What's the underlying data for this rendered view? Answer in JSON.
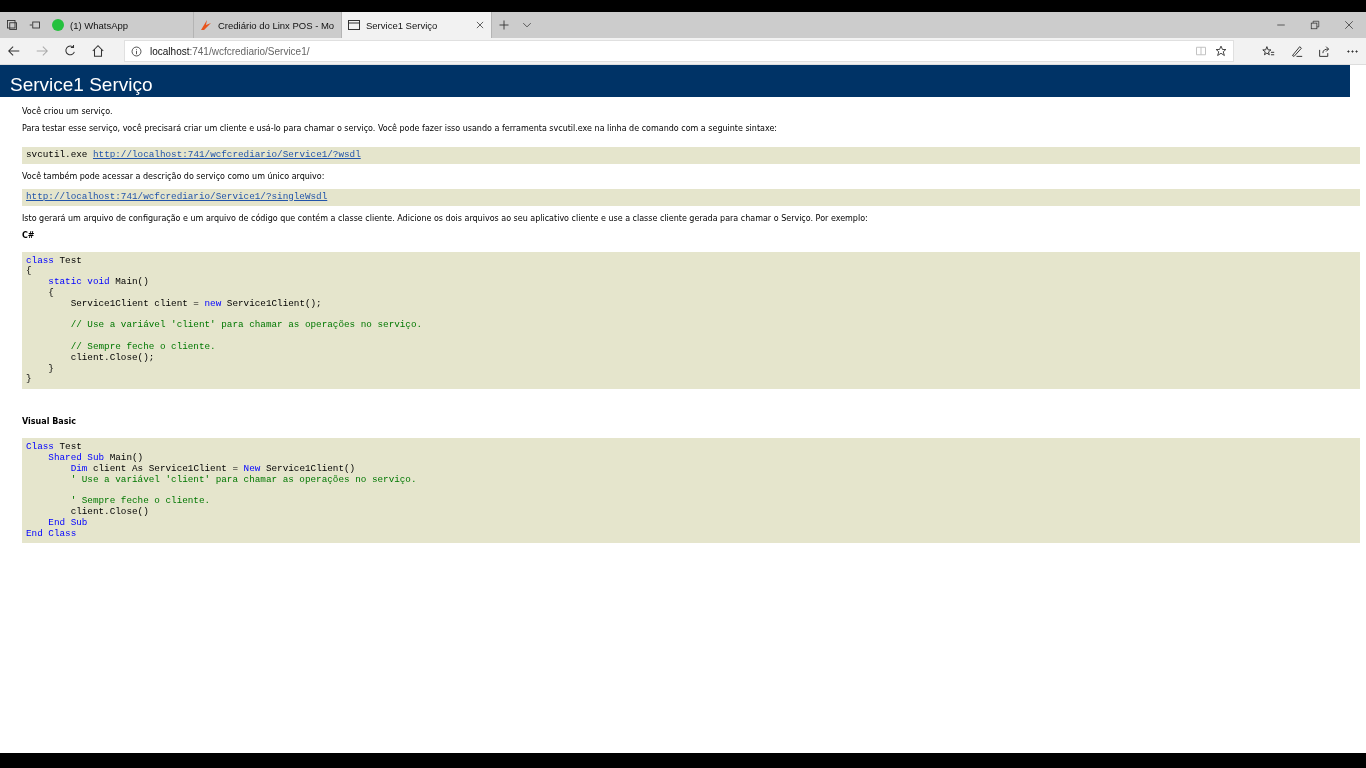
{
  "browser": {
    "tabs": [
      {
        "title": "(1) WhatsApp",
        "kind": "chat",
        "selected": false
      },
      {
        "title": "Crediário do Linx POS - Mo",
        "kind": "flame",
        "selected": false
      },
      {
        "title": "Service1 Serviço",
        "kind": "page",
        "selected": true
      }
    ],
    "address": {
      "host": "localhost",
      "path": ":741/wcfcrediario/Service1/"
    }
  },
  "page": {
    "heading": "Service1 Serviço",
    "intro": "Você criou um serviço.",
    "instructions": "Para testar esse serviço, você precisará criar um cliente e usá-lo para chamar o serviço. Você pode fazer isso usando a ferramenta svcutil.exe na linha de comando com a seguinte sintaxe:",
    "command": {
      "program": "svcutil.exe",
      "link": "http://localhost:741/wcfcrediario/Service1/?wsdl"
    },
    "single_file_text": "Você também pode acessar a descrição do serviço como um único arquivo:",
    "single_file_link": "http://localhost:741/wcfcrediario/Service1/?singleWsdl",
    "generates_text": "Isto gerará um arquivo de configuração e um arquivo de código que contém a classe cliente. Adicione os dois arquivos ao seu aplicativo cliente e use a classe cliente gerada para chamar o Serviço. Por exemplo:",
    "examples": [
      {
        "language": "C#",
        "lines": [
          {
            "kind": "code",
            "tokens": [
              {
                "kind": "keyword",
                "text": "class"
              },
              {
                "kind": "plain",
                "text": " Test"
              }
            ]
          },
          {
            "kind": "code",
            "tokens": [
              {
                "kind": "plain",
                "text": "{"
              }
            ]
          },
          {
            "kind": "code",
            "tokens": [
              {
                "kind": "keyword",
                "text": "    static void"
              },
              {
                "kind": "plain",
                "text": " Main()"
              }
            ]
          },
          {
            "kind": "code",
            "tokens": [
              {
                "kind": "plain",
                "text": "    {"
              }
            ]
          },
          {
            "kind": "code",
            "tokens": [
              {
                "kind": "plain",
                "text": "        Service1Client client = "
              },
              {
                "kind": "keyword",
                "text": "new"
              },
              {
                "kind": "plain",
                "text": " Service1Client();"
              }
            ]
          },
          {
            "kind": "blank"
          },
          {
            "kind": "code",
            "tokens": [
              {
                "kind": "comment",
                "text": "        // Use a variável 'client' para chamar as operações no serviço."
              }
            ]
          },
          {
            "kind": "blank"
          },
          {
            "kind": "code",
            "tokens": [
              {
                "kind": "comment",
                "text": "        // Sempre feche o cliente."
              }
            ]
          },
          {
            "kind": "code",
            "tokens": [
              {
                "kind": "plain",
                "text": "        client.Close();"
              }
            ]
          },
          {
            "kind": "code",
            "tokens": [
              {
                "kind": "plain",
                "text": "    }"
              }
            ]
          },
          {
            "kind": "code",
            "tokens": [
              {
                "kind": "plain",
                "text": "}"
              }
            ]
          }
        ]
      },
      {
        "language": "Visual Basic",
        "lines": [
          {
            "kind": "code",
            "tokens": [
              {
                "kind": "keyword",
                "text": "Class"
              },
              {
                "kind": "plain",
                "text": " Test"
              }
            ]
          },
          {
            "kind": "code",
            "tokens": [
              {
                "kind": "keyword",
                "text": "    Shared Sub"
              },
              {
                "kind": "plain",
                "text": " Main()"
              }
            ]
          },
          {
            "kind": "code",
            "tokens": [
              {
                "kind": "keyword",
                "text": "        Dim"
              },
              {
                "kind": "plain",
                "text": " client As Service1Client = "
              },
              {
                "kind": "keyword",
                "text": "New"
              },
              {
                "kind": "plain",
                "text": " Service1Client()"
              }
            ]
          },
          {
            "kind": "code",
            "tokens": [
              {
                "kind": "comment",
                "text": "        ' Use a variável 'client' para chamar as operações no serviço."
              }
            ]
          },
          {
            "kind": "blank"
          },
          {
            "kind": "code",
            "tokens": [
              {
                "kind": "comment",
                "text": "        ' Sempre feche o cliente."
              }
            ]
          },
          {
            "kind": "code",
            "tokens": [
              {
                "kind": "plain",
                "text": "        client.Close()"
              }
            ]
          },
          {
            "kind": "code",
            "tokens": [
              {
                "kind": "keyword",
                "text": "    End Sub"
              }
            ]
          },
          {
            "kind": "code",
            "tokens": [
              {
                "kind": "keyword",
                "text": "End Class"
              }
            ]
          }
        ]
      }
    ]
  }
}
